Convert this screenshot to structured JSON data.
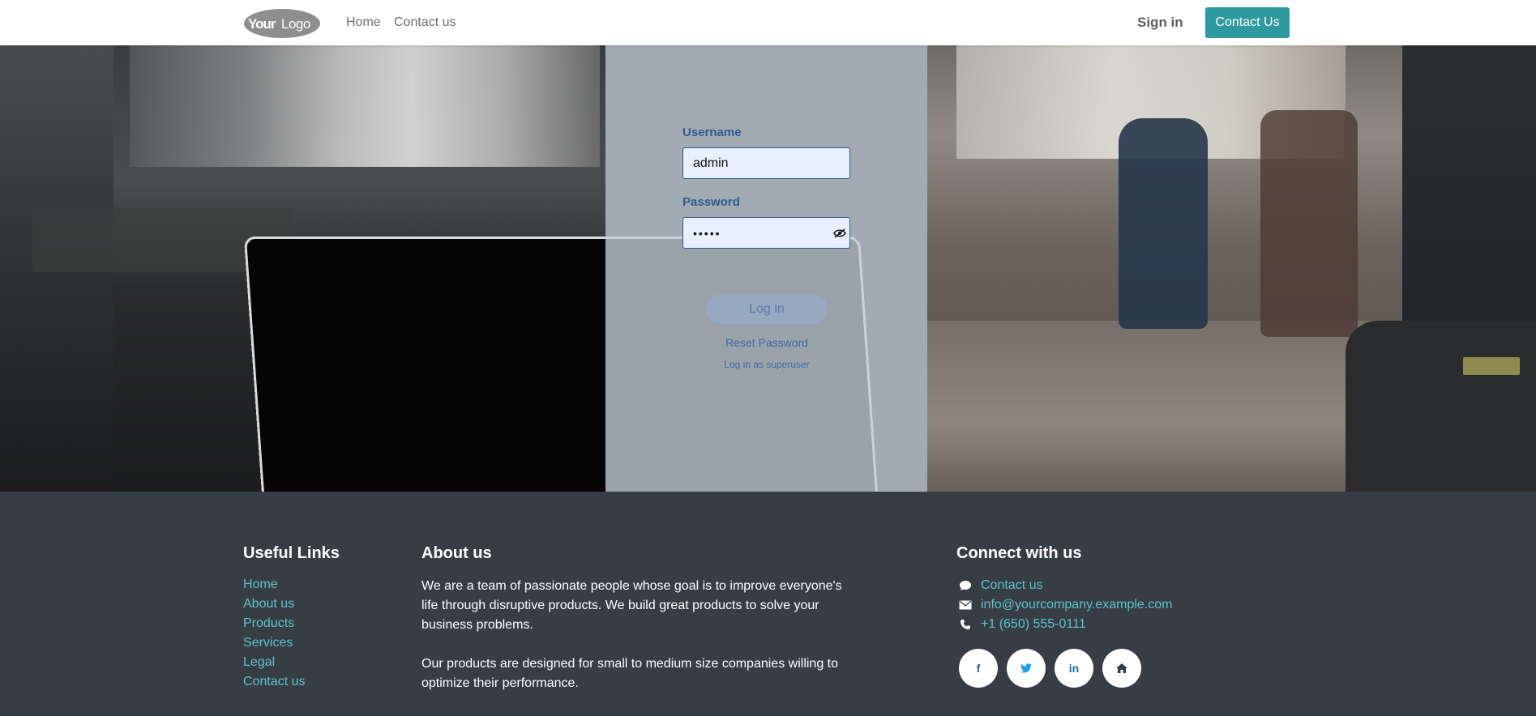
{
  "header": {
    "logo_text": "YourLogo",
    "nav": [
      {
        "label": "Home"
      },
      {
        "label": "Contact us"
      }
    ],
    "sign_in_label": "Sign in",
    "contact_button_label": "Contact Us",
    "accent_color": "#2e9aa0"
  },
  "login": {
    "username_label": "Username",
    "username_value": "admin",
    "password_label": "Password",
    "password_value": "•••••",
    "login_button_label": "Log in",
    "reset_password_label": "Reset Password",
    "superuser_label": "Log in as superuser",
    "label_color": "#2f5a8e"
  },
  "footer": {
    "useful_links_title": "Useful Links",
    "useful_links": [
      "Home",
      "About us",
      "Products",
      "Services",
      "Legal",
      "Contact us"
    ],
    "about_title": "About us",
    "about_p1": "We are a team of passionate people whose goal is to improve everyone's life through disruptive products. We build great products to solve your business problems.",
    "about_p2": "Our products are designed for small to medium size companies willing to optimize their performance.",
    "connect_title": "Connect with us",
    "connect": {
      "contact_label": "Contact us",
      "email": "info@yourcompany.example.com",
      "phone": "+1 (650) 555-0111"
    },
    "social": [
      {
        "icon": "facebook-icon",
        "glyph": "f"
      },
      {
        "icon": "twitter-icon",
        "glyph": "🐦"
      },
      {
        "icon": "linkedin-icon",
        "glyph": "in"
      },
      {
        "icon": "home-icon",
        "glyph": "⌂"
      }
    ],
    "link_color": "#5fc3c7"
  }
}
